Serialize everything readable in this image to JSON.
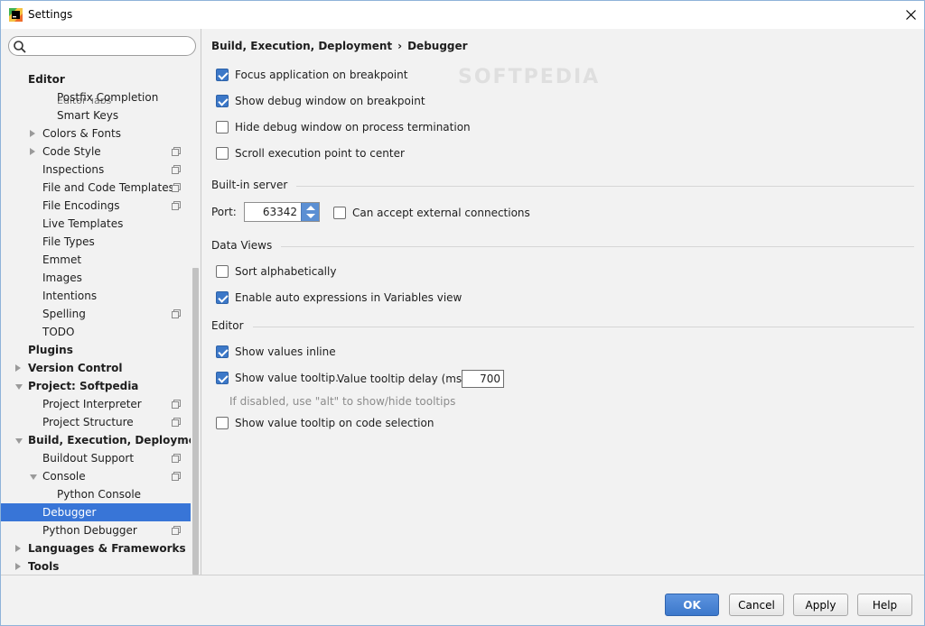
{
  "window": {
    "title": "Settings"
  },
  "search": {
    "placeholder": "",
    "value": ""
  },
  "tree": {
    "cut_item": "Editor Tabs",
    "items": [
      {
        "label": "Editor",
        "level": 0,
        "bold": true,
        "arrow": "none",
        "icon": false,
        "selected": false
      },
      {
        "label": "Postfix Completion",
        "level": 2,
        "bold": false,
        "arrow": "none",
        "icon": false,
        "selected": false
      },
      {
        "label": "Smart Keys",
        "level": 2,
        "bold": false,
        "arrow": "none",
        "icon": false,
        "selected": false
      },
      {
        "label": "Colors & Fonts",
        "level": 1,
        "bold": false,
        "arrow": "right",
        "icon": false,
        "selected": false
      },
      {
        "label": "Code Style",
        "level": 1,
        "bold": false,
        "arrow": "right",
        "icon": true,
        "selected": false
      },
      {
        "label": "Inspections",
        "level": 1,
        "bold": false,
        "arrow": "none",
        "icon": true,
        "selected": false
      },
      {
        "label": "File and Code Templates",
        "level": 1,
        "bold": false,
        "arrow": "none",
        "icon": true,
        "selected": false
      },
      {
        "label": "File Encodings",
        "level": 1,
        "bold": false,
        "arrow": "none",
        "icon": true,
        "selected": false
      },
      {
        "label": "Live Templates",
        "level": 1,
        "bold": false,
        "arrow": "none",
        "icon": false,
        "selected": false
      },
      {
        "label": "File Types",
        "level": 1,
        "bold": false,
        "arrow": "none",
        "icon": false,
        "selected": false
      },
      {
        "label": "Emmet",
        "level": 1,
        "bold": false,
        "arrow": "none",
        "icon": false,
        "selected": false
      },
      {
        "label": "Images",
        "level": 1,
        "bold": false,
        "arrow": "none",
        "icon": false,
        "selected": false
      },
      {
        "label": "Intentions",
        "level": 1,
        "bold": false,
        "arrow": "none",
        "icon": false,
        "selected": false
      },
      {
        "label": "Spelling",
        "level": 1,
        "bold": false,
        "arrow": "none",
        "icon": true,
        "selected": false
      },
      {
        "label": "TODO",
        "level": 1,
        "bold": false,
        "arrow": "none",
        "icon": false,
        "selected": false
      },
      {
        "label": "Plugins",
        "level": 0,
        "bold": true,
        "arrow": "none",
        "icon": false,
        "selected": false
      },
      {
        "label": "Version Control",
        "level": 0,
        "bold": true,
        "arrow": "right",
        "icon": false,
        "selected": false
      },
      {
        "label": "Project: Softpedia",
        "level": 0,
        "bold": true,
        "arrow": "down",
        "icon": false,
        "selected": false
      },
      {
        "label": "Project Interpreter",
        "level": 1,
        "bold": false,
        "arrow": "none",
        "icon": true,
        "selected": false
      },
      {
        "label": "Project Structure",
        "level": 1,
        "bold": false,
        "arrow": "none",
        "icon": true,
        "selected": false
      },
      {
        "label": "Build, Execution, Deployment",
        "level": 0,
        "bold": true,
        "arrow": "down",
        "icon": false,
        "selected": false
      },
      {
        "label": "Buildout Support",
        "level": 1,
        "bold": false,
        "arrow": "none",
        "icon": true,
        "selected": false
      },
      {
        "label": "Console",
        "level": 1,
        "bold": false,
        "arrow": "down",
        "icon": true,
        "selected": false
      },
      {
        "label": "Python Console",
        "level": 2,
        "bold": false,
        "arrow": "none",
        "icon": false,
        "selected": false
      },
      {
        "label": "Debugger",
        "level": 1,
        "bold": false,
        "arrow": "none",
        "icon": false,
        "selected": true
      },
      {
        "label": "Python Debugger",
        "level": 1,
        "bold": false,
        "arrow": "none",
        "icon": true,
        "selected": false
      },
      {
        "label": "Languages & Frameworks",
        "level": 0,
        "bold": true,
        "arrow": "right",
        "icon": false,
        "selected": false
      },
      {
        "label": "Tools",
        "level": 0,
        "bold": true,
        "arrow": "right",
        "icon": false,
        "selected": false
      }
    ]
  },
  "breadcrumb": {
    "parent": "Build, Execution, Deployment",
    "separator": "›",
    "current": "Debugger"
  },
  "watermark": "SOFTPEDIA",
  "options": {
    "focus_app": {
      "label": "Focus application on breakpoint",
      "checked": true
    },
    "show_debug": {
      "label": "Show debug window on breakpoint",
      "checked": true
    },
    "hide_debug": {
      "label": "Hide debug window on process termination",
      "checked": false
    },
    "scroll_center": {
      "label": "Scroll execution point to center",
      "checked": false
    }
  },
  "builtin_server": {
    "section": "Built-in server",
    "port_label": "Port:",
    "port_value": "63342",
    "external": {
      "label": "Can accept external connections",
      "checked": false
    }
  },
  "data_views": {
    "section": "Data Views",
    "sort_alpha": {
      "label": "Sort alphabetically",
      "checked": false
    },
    "auto_expr": {
      "label": "Enable auto expressions in Variables view",
      "checked": true
    }
  },
  "editor": {
    "section": "Editor",
    "values_inline": {
      "label": "Show values inline",
      "checked": true
    },
    "value_tooltip": {
      "label": "Show value tooltip.",
      "checked": true
    },
    "delay_label": "Value tooltip delay (ms):",
    "delay_value": "700",
    "hint": "If disabled, use \"alt\" to show/hide tooltips",
    "tooltip_selection": {
      "label": "Show value tooltip on code selection",
      "checked": false
    }
  },
  "buttons": {
    "ok": "OK",
    "cancel": "Cancel",
    "apply": "Apply",
    "help": "Help"
  }
}
